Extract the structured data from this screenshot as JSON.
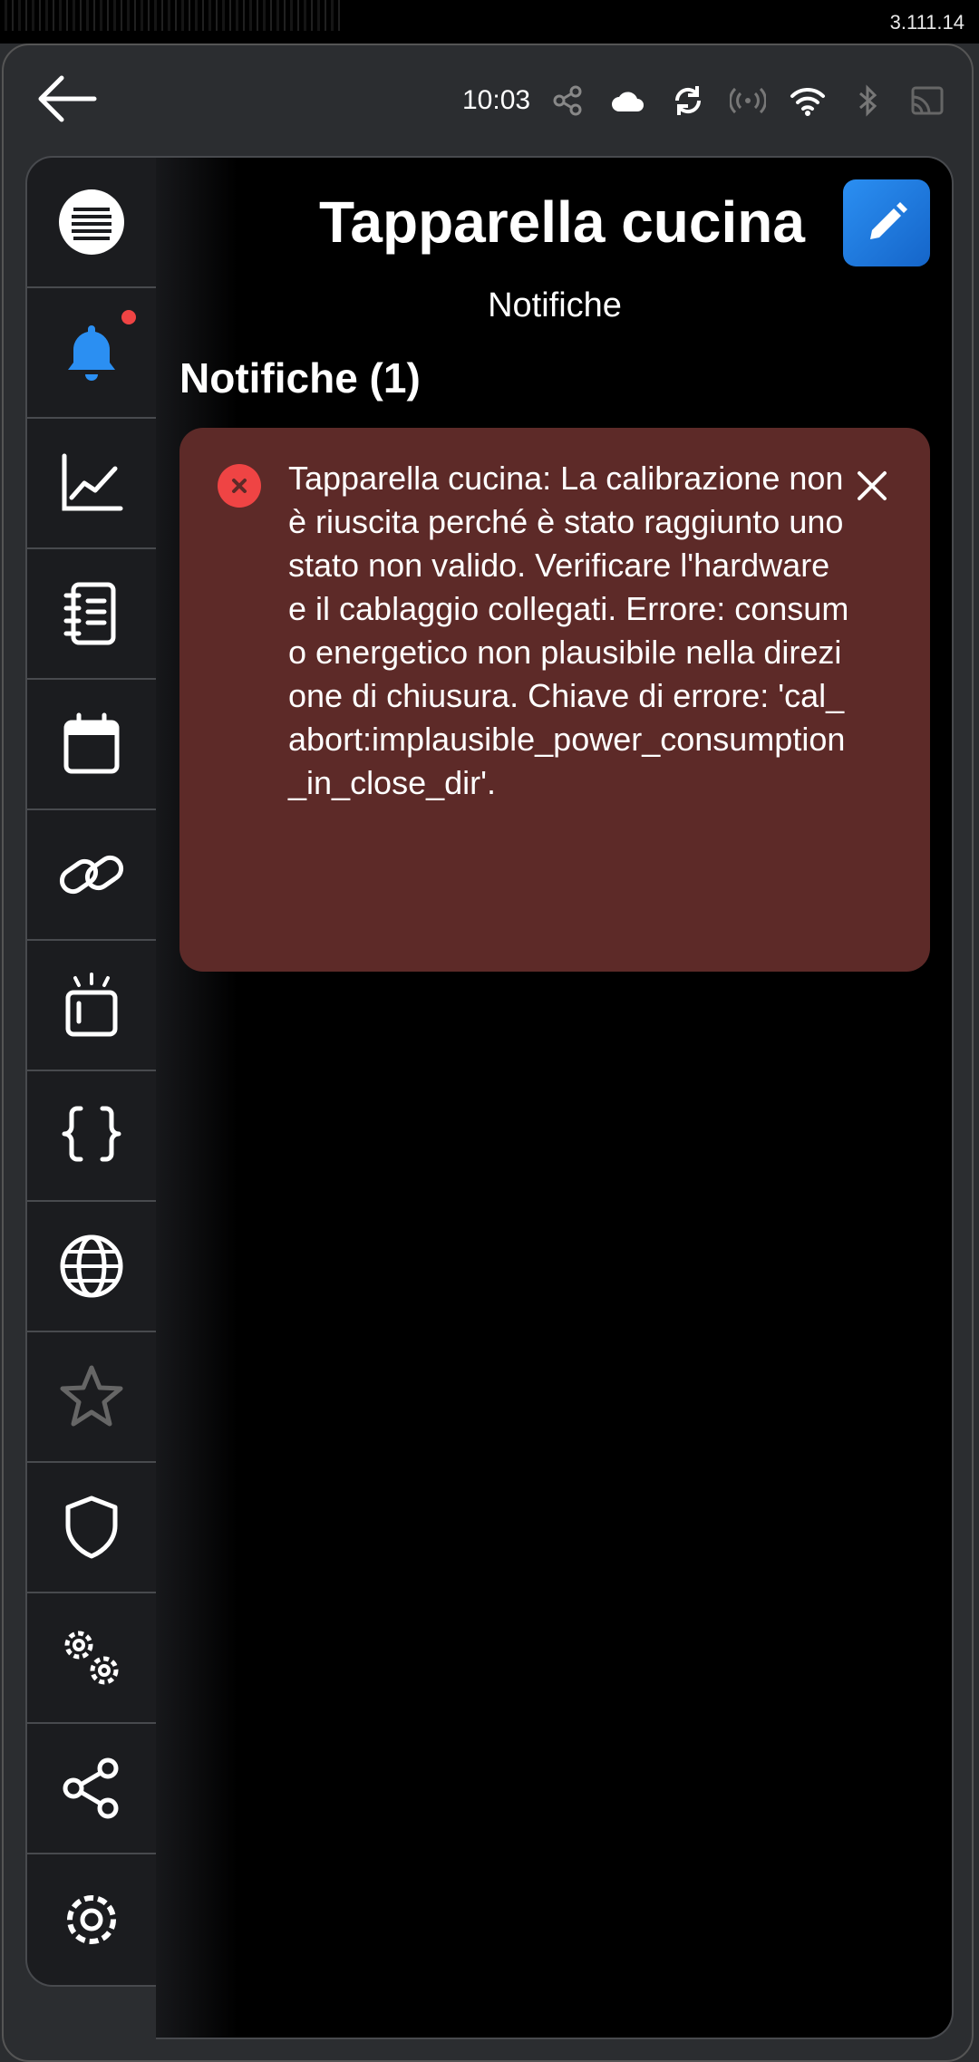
{
  "app": {
    "version": "3.111.14",
    "time": "10:03"
  },
  "colors": {
    "accent": "#2b8ff2",
    "error_bg": "#5d2a28",
    "error_icon": "#ef4444",
    "active_nav": "#2b8ff2"
  },
  "status_icons": [
    "share-icon",
    "cloud-icon",
    "sync-icon",
    "broadcast-icon",
    "wifi-icon",
    "bluetooth-icon",
    "cast-icon"
  ],
  "sidebar": {
    "items": [
      {
        "name": "menu-icon",
        "active": false
      },
      {
        "name": "notifications-icon",
        "active": true,
        "badge": true
      },
      {
        "name": "chart-icon",
        "active": false
      },
      {
        "name": "notebook-icon",
        "active": false
      },
      {
        "name": "calendar-icon",
        "active": false
      },
      {
        "name": "link-icon",
        "active": false
      },
      {
        "name": "alarm-icon",
        "active": false
      },
      {
        "name": "braces-icon",
        "active": false
      },
      {
        "name": "globe-icon",
        "active": false
      },
      {
        "name": "star-icon",
        "active": false
      },
      {
        "name": "shield-icon",
        "active": false
      },
      {
        "name": "gears-icon",
        "active": false
      },
      {
        "name": "share-icon",
        "active": false
      },
      {
        "name": "settings-icon",
        "active": false
      }
    ]
  },
  "page": {
    "title": "Tapparella cucina",
    "subtitle": "Notifiche"
  },
  "notifications": {
    "heading": "Notifiche (1)",
    "items": [
      {
        "severity": "error",
        "text": "Tapparella cucina: La calibrazione non è riuscita perché è stato raggiunto uno stato non valido. Verificare l'hardware e il cablaggio collegati. Errore: consumo energetico non plausibile nella direzione di chiusura. Chiave di errore: 'cal_abort:implausible_power_consumption_in_close_dir'."
      }
    ]
  }
}
